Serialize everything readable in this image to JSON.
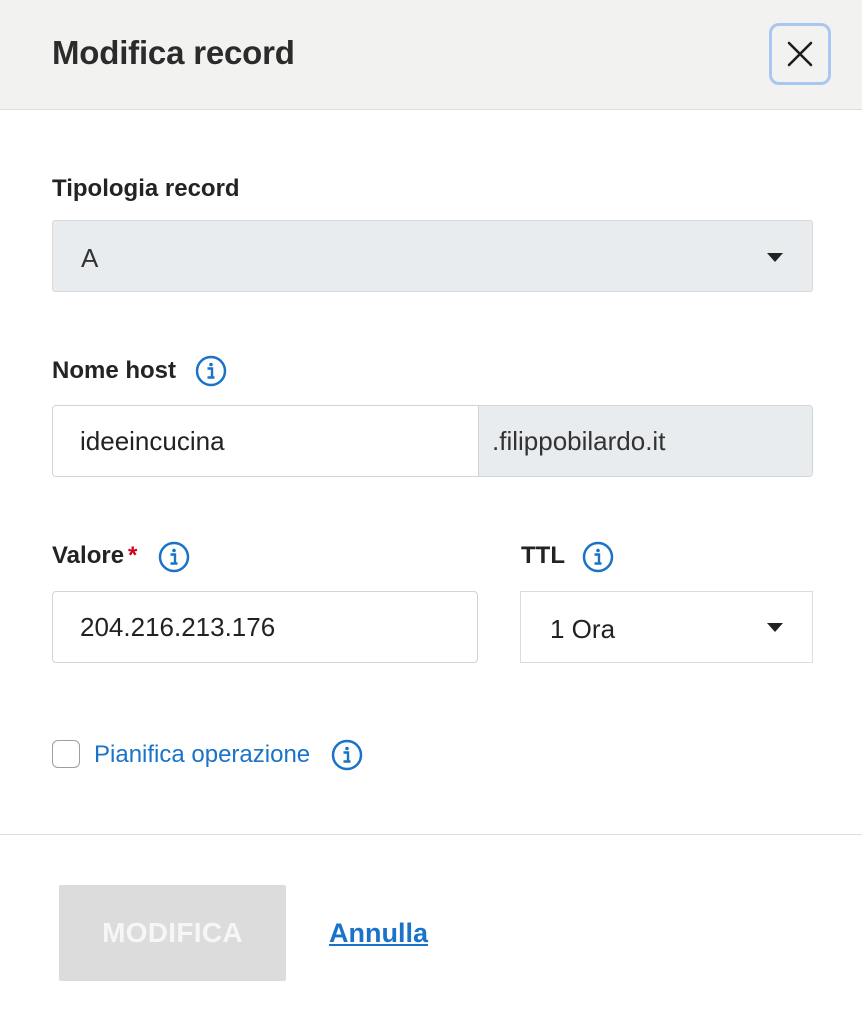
{
  "dialog": {
    "title": "Modifica record",
    "close_icon": "close-icon"
  },
  "form": {
    "record_type": {
      "label": "Tipologia record",
      "selected": "A"
    },
    "host": {
      "label": "Nome host",
      "value": "ideeincucina",
      "suffix": ".filippobilardo.it"
    },
    "valore": {
      "label": "Valore",
      "required_mark": "*",
      "value": "204.216.213.176"
    },
    "ttl": {
      "label": "TTL",
      "selected": "1 Ora"
    },
    "schedule": {
      "label": "Pianifica operazione",
      "checked": false
    }
  },
  "actions": {
    "submit_label": "MODIFICA",
    "cancel_label": "Annulla"
  },
  "colors": {
    "accent": "#1a73c8",
    "required": "#d0021b",
    "disabled_button": "#dcdcdc",
    "header_bg": "#f2f2f1"
  }
}
